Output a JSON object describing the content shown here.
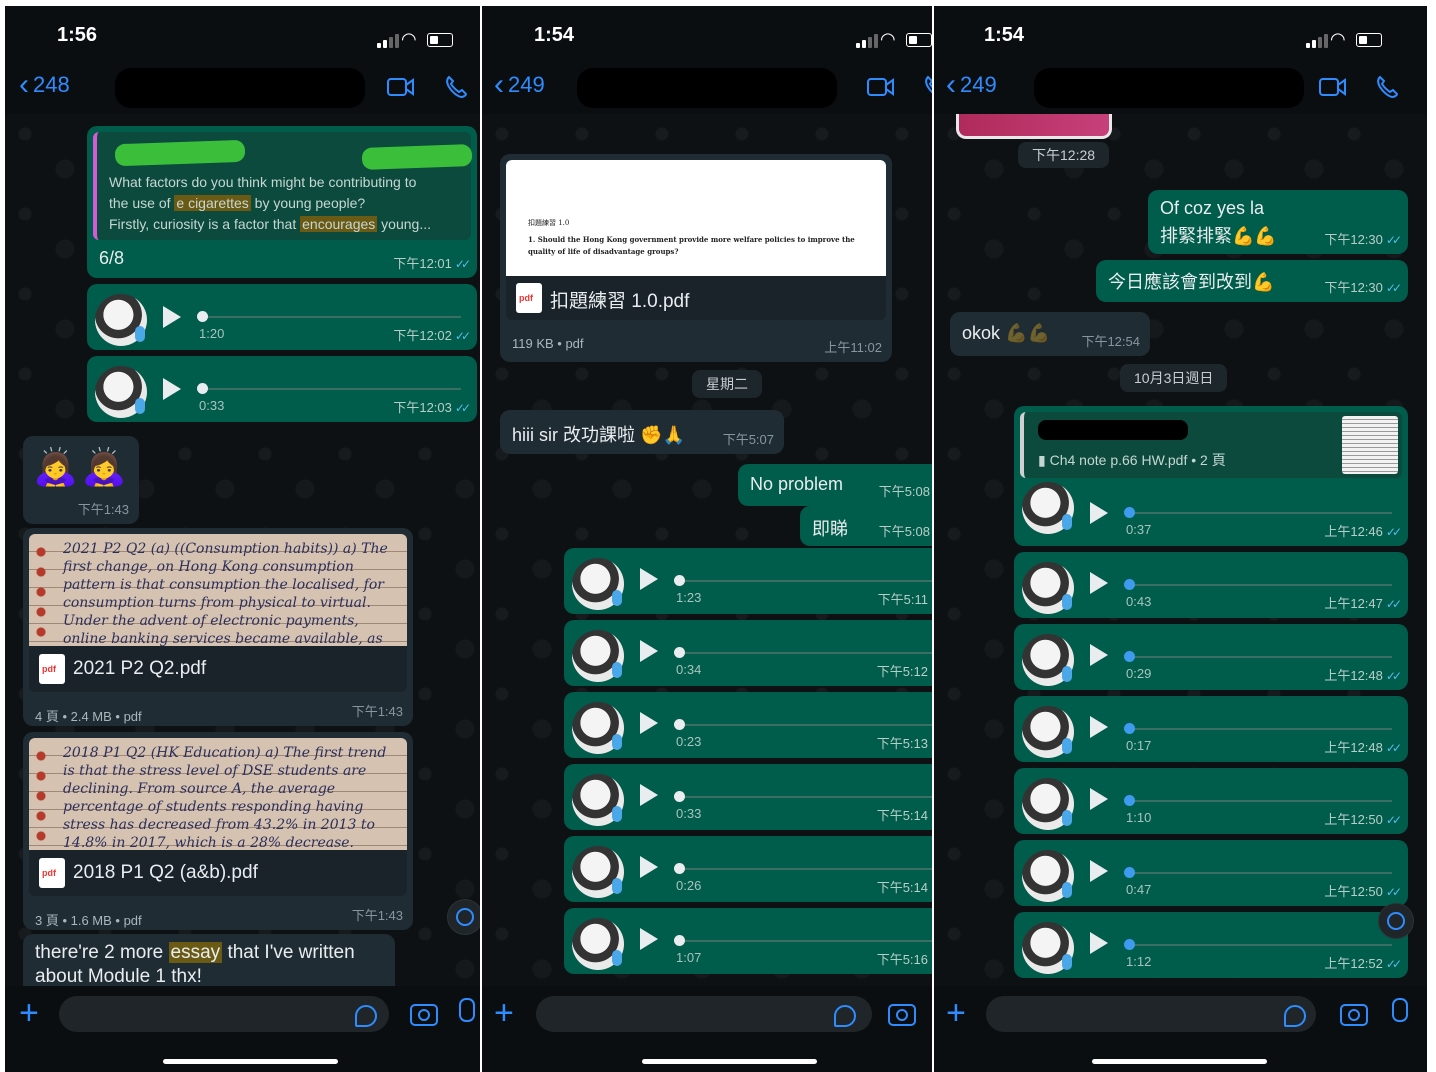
{
  "panels": [
    {
      "status_time": "1:56",
      "back_count": "248",
      "quote": {
        "line1": "What factors do you think might be contributing to",
        "line2_a": "the use of ",
        "line2_hl": "e cigarettes",
        "line2_b": " by young people?",
        "line3_a": "Firstly, curiosity is a factor that ",
        "line3_hl": "encourages",
        "line3_b": " young...",
        "reply": "6/8",
        "time": "下午12:01"
      },
      "voices": [
        {
          "duration": "1:20",
          "time": "下午12:02"
        },
        {
          "duration": "0:33",
          "time": "下午12:03"
        }
      ],
      "emoji_msg": {
        "emoji": "🙇‍♀️🙇‍♀️",
        "time": "下午1:43"
      },
      "docs": [
        {
          "preview": "2021 P2 Q2 (a) ((Consumption habits)) a) The first change, on Hong Kong consumption pattern is that consumption the localised, for consumption turns from physical to virtual. Under the advent of electronic payments, online banking services became available, as banks allowing their clients to access and conduct transactions, payments, online platform.",
          "name": "2021 P2 Q2.pdf",
          "meta": "4 頁 • 2.4 MB • pdf",
          "time": "下午1:43"
        },
        {
          "preview": "2018 P1 Q2 (HK Education) a) The first trend is that the stress level of DSE students are declining. From source A, the average percentage of students responding having stress has decreased from 43.2% in 2013 to 14.8% in 2017, which is a 28% decrease. Among the sources of stress, the highest and lowest proportion.",
          "name": "2018 P1 Q2 (a&b).pdf",
          "meta": "3 頁 • 1.6 MB • pdf",
          "time": "下午1:43"
        }
      ],
      "last_msg_a": "there're 2 more ",
      "last_msg_hl": "essay",
      "last_msg_b": " that I've written",
      "last_msg_line2": "about Module 1 thx!",
      "input_placeholder": ""
    },
    {
      "status_time": "1:54",
      "back_count": "249",
      "doc": {
        "preview_title": "扣題練習 1.0",
        "preview_q": "1. Should the Hong Kong government provide more welfare policies to improve the quality of life of disadvantage groups?",
        "name": "扣題練習 1.0.pdf",
        "meta": "119 KB • pdf",
        "time": "上午11:02"
      },
      "date_chip": "星期二",
      "in_msg": {
        "text": "hiii sir 改功課啦",
        "emoji": "✊🙏",
        "time": "下午5:07"
      },
      "out_msgs": [
        {
          "text": "No problem",
          "time": "下午5:08"
        },
        {
          "text": "即睇",
          "time": "下午5:08"
        }
      ],
      "voices": [
        {
          "duration": "1:23",
          "time": "下午5:11"
        },
        {
          "duration": "0:34",
          "time": "下午5:12"
        },
        {
          "duration": "0:23",
          "time": "下午5:13"
        },
        {
          "duration": "0:33",
          "time": "下午5:14"
        },
        {
          "duration": "0:26",
          "time": "下午5:14"
        },
        {
          "duration": "1:07",
          "time": "下午5:16"
        }
      ]
    },
    {
      "status_time": "1:54",
      "back_count": "249",
      "top_time": "下午12:28",
      "out_msgs": [
        {
          "line1": "Of coz yes la",
          "line2": "排緊排緊",
          "emoji": "💪💪",
          "time": "下午12:30"
        },
        {
          "line1": "今日應該會到改到",
          "emoji": "💪",
          "time": "下午12:30"
        }
      ],
      "in_msg": {
        "text": "okok",
        "emoji": "💪💪",
        "time": "下午12:54"
      },
      "date_chip": "10月3日週日",
      "quote_doc": "Ch4 note p.66 HW.pdf • 2 頁",
      "voices": [
        {
          "duration": "0:37",
          "time": "上午12:46"
        },
        {
          "duration": "0:43",
          "time": "上午12:47"
        },
        {
          "duration": "0:29",
          "time": "上午12:48"
        },
        {
          "duration": "0:17",
          "time": "上午12:48"
        },
        {
          "duration": "1:10",
          "time": "上午12:50"
        },
        {
          "duration": "0:47",
          "time": "上午12:50"
        },
        {
          "duration": "1:12",
          "time": "上午12:52"
        }
      ]
    }
  ],
  "icons": {
    "back": "chevron-left-icon",
    "video": "video-camera-icon",
    "call": "phone-icon",
    "plus": "plus-icon",
    "sticker": "sticker-icon",
    "camera": "camera-icon",
    "mic": "microphone-icon",
    "scroll": "chevron-down-icon"
  },
  "colors": {
    "accent": "#2f8cff",
    "outgoing_bubble": "#005c4b",
    "incoming_bubble": "#202c33",
    "read_tick": "#53bdeb"
  }
}
